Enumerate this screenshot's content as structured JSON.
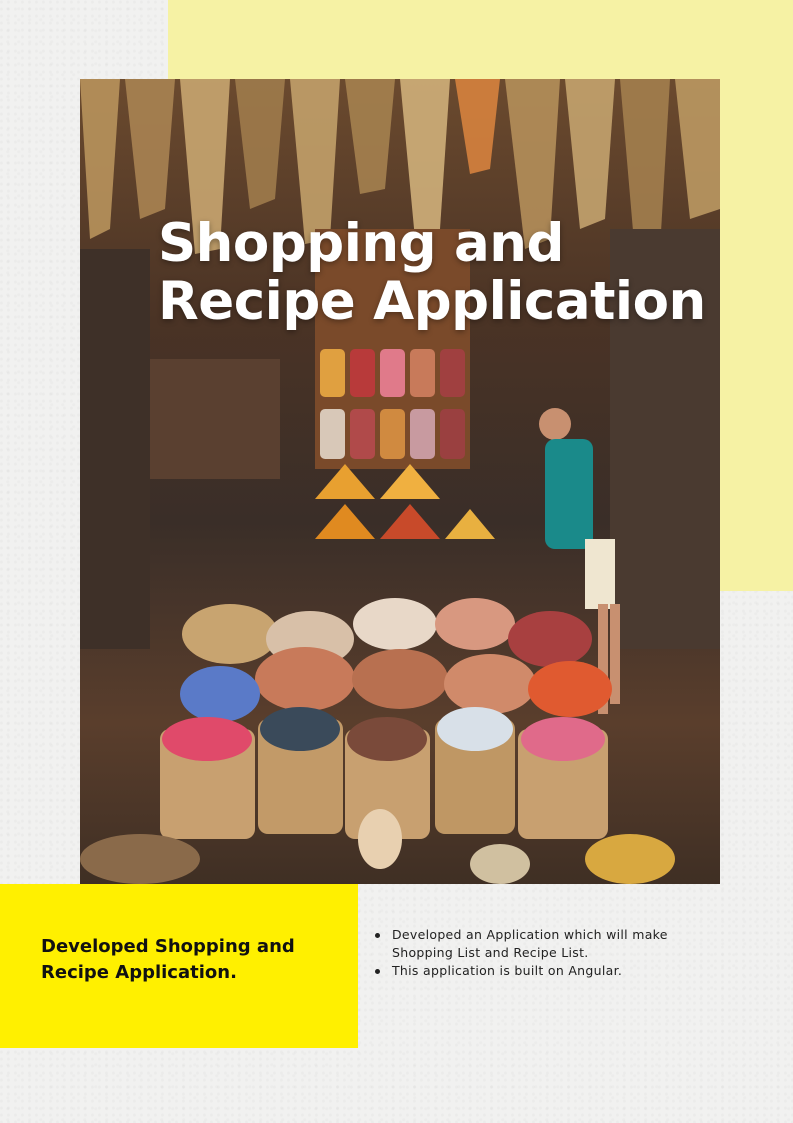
{
  "hero": {
    "title_line1": "Shopping and",
    "title_line2": "Recipe Application",
    "image_description_icon": "spice-market-photo"
  },
  "caption": {
    "heading": "Developed Shopping and Recipe Application."
  },
  "details": {
    "bullets": [
      "Developed an Application which will make Shopping List and Recipe List.",
      "This application is built on Angular."
    ]
  },
  "colors": {
    "accent_yellow": "#fff000",
    "pale_yellow": "#f6f2a4",
    "background": "#f1f1f0"
  }
}
